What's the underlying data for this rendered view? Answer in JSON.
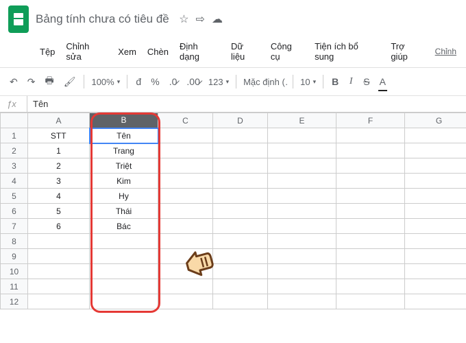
{
  "titlebar": {
    "title": "Bảng tính chưa có tiêu đề",
    "star_icon": "☆",
    "move_icon": "⇨",
    "cloud_icon": "☁"
  },
  "menubar": {
    "items": [
      "Tệp",
      "Chỉnh sửa",
      "Xem",
      "Chèn",
      "Định dạng",
      "Dữ liệu",
      "Công cụ",
      "Tiện ích bổ sung",
      "Trợ giúp"
    ],
    "edit_link": "Chỉnh"
  },
  "toolbar": {
    "zoom": "100%",
    "currency": "đ",
    "percent": "%",
    "dec_less": ".0̷",
    "dec_more": ".00̷",
    "format123": "123",
    "font": "Mặc định (…",
    "size": "10",
    "bold": "B",
    "italic": "I",
    "strike": "S",
    "textcolor": "A"
  },
  "formula": {
    "fx": "ƒx",
    "value": "Tên"
  },
  "grid": {
    "columns": [
      "A",
      "B",
      "C",
      "D",
      "E",
      "F",
      "G"
    ],
    "selected_col": "B",
    "rows": [
      {
        "n": "1",
        "A": "STT",
        "B": "Tên"
      },
      {
        "n": "2",
        "A": "1",
        "B": "Trang"
      },
      {
        "n": "3",
        "A": "2",
        "B": "Triệt"
      },
      {
        "n": "4",
        "A": "3",
        "B": "Kim"
      },
      {
        "n": "5",
        "A": "4",
        "B": "Hy"
      },
      {
        "n": "6",
        "A": "5",
        "B": "Thái"
      },
      {
        "n": "7",
        "A": "6",
        "B": "Bác"
      },
      {
        "n": "8",
        "A": "",
        "B": ""
      },
      {
        "n": "9",
        "A": "",
        "B": ""
      },
      {
        "n": "10",
        "A": "",
        "B": ""
      },
      {
        "n": "11",
        "A": "",
        "B": ""
      },
      {
        "n": "12",
        "A": "",
        "B": ""
      }
    ]
  },
  "pointer_hand": "👈"
}
